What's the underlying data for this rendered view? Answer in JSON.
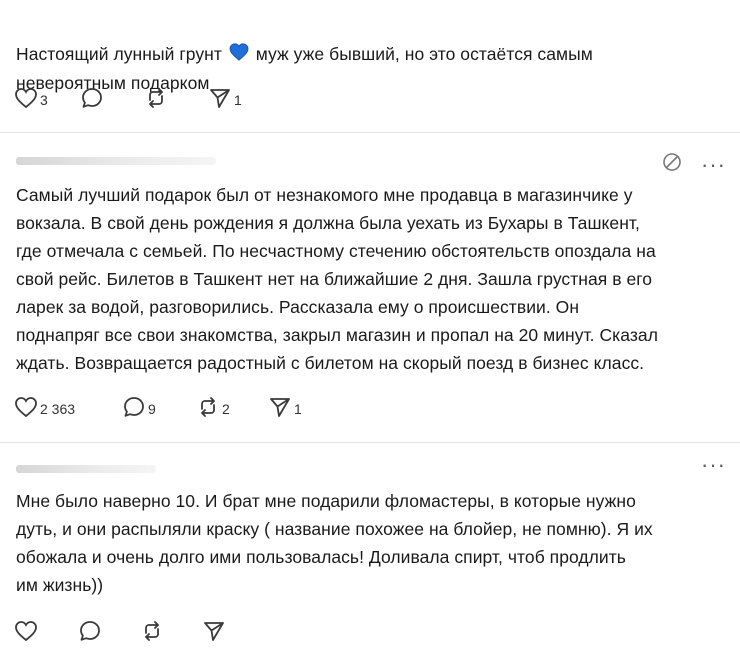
{
  "post1": {
    "text_before": "Настоящий лунный грунт ",
    "text_after": " муж уже бывший, но это остаётся самым\nневероятным подарком",
    "emoji": "blue-heart",
    "likes": "3",
    "comments": "",
    "reposts": "",
    "shares": "1"
  },
  "post2": {
    "text": "Самый лучший подарок был от незнакомого мне продавца в магазинчике у\nвокзала. В свой день рождения я должна была уехать из Бухары в Ташкент,\nгде отмечала с семьей. По несчастному стечению обстоятельств опоздала на\nсвой рейс. Билетов в Ташкент нет на ближайшие 2 дня. Зашла грустная в его\nларек за водой, разговорились. Рассказала ему о происшествии. Он\nподнапряг все свои знакомства, закрыл магазин и пропал на 20 минут. Сказал\nждать. Возвращается радостный с билетом на скорый поезд в бизнес класс.",
    "likes": "2 363",
    "comments": "9",
    "reposts": "2",
    "shares": "1"
  },
  "post3": {
    "text": "Мне было наверно 10. И брат мне подарили фломастеры, в которые нужно\nдуть, и они распыляли краску ( название похожее на блойер, не помню). Я их\nобожала и очень долго ими пользовалась! Доливала спирт, чтоб продлить\nим жизнь))",
    "likes": "",
    "comments": "",
    "reposts": "",
    "shares": ""
  },
  "icons": {
    "like": "heart-outline-icon",
    "comment": "speech-bubble-icon",
    "repost": "repost-arrows-icon",
    "share": "paper-plane-icon",
    "more": "more-dots-icon",
    "mute": "muted-circle-icon"
  },
  "more_label": "···",
  "colors": {
    "text": "#1a1a1a",
    "icon": "#3a3a3a",
    "divider": "#e3e3e3",
    "heart": "#1e6fd9"
  }
}
